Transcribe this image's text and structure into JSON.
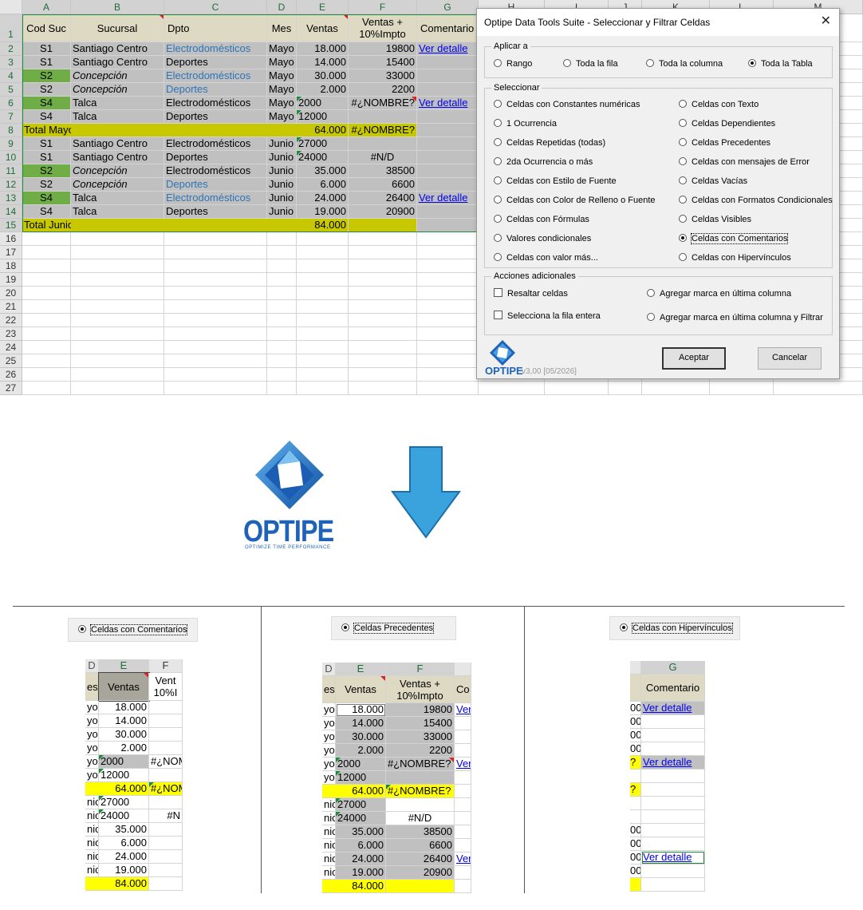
{
  "spreadsheet": {
    "columns": [
      "A",
      "B",
      "C",
      "D",
      "E",
      "F",
      "G",
      "H",
      "I",
      "J",
      "K",
      "L",
      "M"
    ],
    "rows": [
      "1",
      "2",
      "3",
      "4",
      "5",
      "6",
      "7",
      "8",
      "9",
      "10",
      "11",
      "12",
      "13",
      "14",
      "15",
      "16",
      "17",
      "18",
      "19",
      "20",
      "21",
      "22",
      "23",
      "24",
      "25",
      "26",
      "27"
    ],
    "header": {
      "cod": "Cod Suc",
      "sucursal": "Sucursal",
      "dpto": "Dpto",
      "mes": "Mes",
      "ventas": "Ventas",
      "ventas_imp_1": "Ventas +",
      "ventas_imp_2": "10%Impto",
      "comentario": "Comentario"
    },
    "data": [
      [
        "S1",
        "Santiago Centro",
        "Electrodomésticos",
        "Mayo",
        "18.000",
        "19800",
        "Ver detalle"
      ],
      [
        "S1",
        "Santiago Centro",
        "Deportes",
        "Mayo",
        "14.000",
        "15400",
        ""
      ],
      [
        "S2",
        "Concepción",
        "Electrodomésticos",
        "Mayo",
        "30.000",
        "33000",
        ""
      ],
      [
        "S2",
        "Concepción",
        "Deportes",
        "Mayo",
        "2.000",
        "2200",
        ""
      ],
      [
        "S4",
        "Talca",
        "Electrodomésticos",
        "Mayo",
        "2000",
        "#¿NOMBRE?",
        "Ver detalle"
      ],
      [
        "S4",
        "Talca",
        "Deportes",
        "Mayo",
        "12000",
        "",
        ""
      ],
      [
        "Total Mayo",
        "",
        "",
        "",
        "64.000",
        "#¿NOMBRE?",
        ""
      ],
      [
        "S1",
        "Santiago Centro",
        "Electrodomésticos",
        "Junio",
        "27000",
        "",
        ""
      ],
      [
        "S1",
        "Santiago Centro",
        "Deportes",
        "Junio",
        "24000",
        "#N/D",
        ""
      ],
      [
        "S2",
        "Concepción",
        "Electrodomésticos",
        "Junio",
        "35.000",
        "38500",
        ""
      ],
      [
        "S2",
        "Concepción",
        "Deportes",
        "Junio",
        "6.000",
        "6600",
        ""
      ],
      [
        "S4",
        "Talca",
        "Electrodomésticos",
        "Junio",
        "24.000",
        "26400",
        "Ver detalle"
      ],
      [
        "S4",
        "Talca",
        "Deportes",
        "Junio",
        "19.000",
        "20900",
        ""
      ],
      [
        "Total Junio",
        "",
        "",
        "",
        "84.000",
        "",
        ""
      ]
    ]
  },
  "dialog": {
    "title": "Optipe Data Tools Suite - Seleccionar y Filtrar Celdas",
    "close": "✕",
    "apply_legend": "Aplicar a",
    "apply_options": [
      "Rango",
      "Toda la fila",
      "Toda la columna",
      "Toda la Tabla"
    ],
    "select_legend": "Seleccionar",
    "select_left": [
      "Celdas con Constantes numéricas",
      "1 Ocurrencia",
      "Celdas Repetidas (todas)",
      "2da Ocurrencia o más",
      "Celdas con Estilo de Fuente",
      "Celdas con Color de Relleno o Fuente",
      "Celdas con Fórmulas",
      "Valores condicionales",
      "Celdas con valor más..."
    ],
    "select_right": [
      "Celdas con Texto",
      "Celdas Dependientes",
      "Celdas Precedentes",
      "Celdas con mensajes de Error",
      "Celdas Vacías",
      "Celdas con Formatos Condicionales",
      "Celdas Visibles",
      "Celdas con Comentarios",
      "Celdas con Hipervínculos"
    ],
    "actions_legend": "Acciones adicionales",
    "actions_left": [
      "Resaltar celdas",
      "Selecciona la fila entera"
    ],
    "actions_right": [
      "Agregar marca en última columna",
      "Agregar marca en última columna y Filtrar"
    ],
    "brand": "OPTIPE",
    "version": "v3,00 [05/2026]",
    "ok": "Aceptar",
    "cancel": "Cancelar"
  },
  "logo": {
    "name": "OPTIPE",
    "tagline": "OPTIMIZE TIME PERFORMANCE"
  },
  "colors": {
    "accent": "#2e75b6",
    "arrow": "#3aa3de",
    "total_fill": "#c8c800",
    "highlight": "#ffff00",
    "table_fill": "#c0c0c0",
    "green_fill": "#70ad47"
  },
  "panels": {
    "p1": {
      "option": "Celdas con Comentarios",
      "col_d": "D",
      "col_e": "E",
      "col_f": "F",
      "head_d": "es",
      "head_e": "Ventas",
      "head_f1": "Vent",
      "head_f2": "10%I",
      "rows": [
        [
          "yo",
          "18.000",
          ""
        ],
        [
          "yo",
          "14.000",
          ""
        ],
        [
          "yo",
          "30.000",
          ""
        ],
        [
          "yo",
          "2.000",
          ""
        ],
        [
          "yo",
          "2000",
          "#¿NOM"
        ],
        [
          "yo",
          "12000",
          ""
        ],
        [
          "",
          "64.000",
          "#¿NOM"
        ],
        [
          "nio",
          "27000",
          ""
        ],
        [
          "nio",
          "24000",
          "#N"
        ],
        [
          "nio",
          "35.000",
          ""
        ],
        [
          "nio",
          "6.000",
          ""
        ],
        [
          "nio",
          "24.000",
          ""
        ],
        [
          "nio",
          "19.000",
          ""
        ],
        [
          "",
          "84.000",
          ""
        ]
      ]
    },
    "p2": {
      "option": "Celdas Precedentes",
      "col_d": "D",
      "col_e": "E",
      "col_f": "F",
      "head_d": "es",
      "head_e": "Ventas",
      "head_f1": "Ventas +",
      "head_f2": "10%Impto",
      "head_g": "Co",
      "rows": [
        [
          "yo",
          "18.000",
          "19800",
          "Ver"
        ],
        [
          "yo",
          "14.000",
          "15400",
          ""
        ],
        [
          "yo",
          "30.000",
          "33000",
          ""
        ],
        [
          "yo",
          "2.000",
          "2200",
          ""
        ],
        [
          "yo",
          "2000",
          "#¿NOMBRE?",
          "Ver"
        ],
        [
          "yo",
          "12000",
          "",
          ""
        ],
        [
          "",
          "64.000",
          "#¿NOMBRE?",
          ""
        ],
        [
          "nio",
          "27000",
          "",
          ""
        ],
        [
          "nio",
          "24000",
          "#N/D",
          ""
        ],
        [
          "nio",
          "35.000",
          "38500",
          ""
        ],
        [
          "nio",
          "6.000",
          "6600",
          ""
        ],
        [
          "nio",
          "24.000",
          "26400",
          "Ver"
        ],
        [
          "nio",
          "19.000",
          "20900",
          ""
        ],
        [
          "",
          "84.000",
          "",
          ""
        ]
      ]
    },
    "p3": {
      "option": "Celdas con Hipervínculos",
      "col_g": "G",
      "head_g": "Comentario",
      "rows": [
        [
          "00",
          "Ver detalle"
        ],
        [
          "00",
          ""
        ],
        [
          "00",
          ""
        ],
        [
          "00",
          ""
        ],
        [
          "?",
          "Ver detalle"
        ],
        [
          "",
          ""
        ],
        [
          "?",
          ""
        ],
        [
          "",
          ""
        ],
        [
          "",
          ""
        ],
        [
          "00",
          ""
        ],
        [
          "00",
          ""
        ],
        [
          "00",
          "Ver detalle"
        ],
        [
          "00",
          ""
        ],
        [
          "",
          ""
        ]
      ]
    }
  }
}
